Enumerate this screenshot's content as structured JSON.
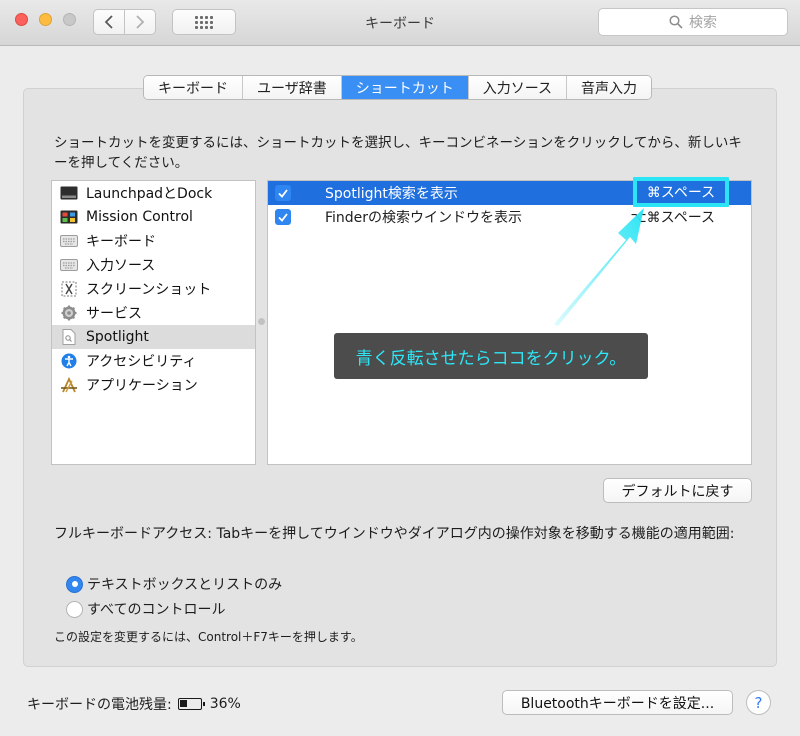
{
  "window": {
    "title": "キーボード"
  },
  "search": {
    "placeholder": "検索"
  },
  "tabs": [
    {
      "label": "キーボード",
      "active": false
    },
    {
      "label": "ユーザ辞書",
      "active": false
    },
    {
      "label": "ショートカット",
      "active": true
    },
    {
      "label": "入力ソース",
      "active": false
    },
    {
      "label": "音声入力",
      "active": false
    }
  ],
  "instructions": "ショートカットを変更するには、ショートカットを選択し、キーコンビネーションをクリックしてから、新しいキーを押してください。",
  "categories": [
    {
      "label": "LaunchpadとDock",
      "icon": "launchpad-icon"
    },
    {
      "label": "Mission Control",
      "icon": "mission-control-icon"
    },
    {
      "label": "キーボード",
      "icon": "keyboard-icon"
    },
    {
      "label": "入力ソース",
      "icon": "keyboard-icon"
    },
    {
      "label": "スクリーンショット",
      "icon": "screenshot-icon"
    },
    {
      "label": "サービス",
      "icon": "gear-icon"
    },
    {
      "label": "Spotlight",
      "icon": "spotlight-icon",
      "selected": true
    },
    {
      "label": "アクセシビリティ",
      "icon": "accessibility-icon"
    },
    {
      "label": "アプリケーション",
      "icon": "app-store-icon"
    }
  ],
  "shortcuts": [
    {
      "label": "Spotlight検索を表示",
      "keys": "⌘スペース",
      "checked": true,
      "selected": true
    },
    {
      "label": "Finderの検索ウインドウを表示",
      "keys": "⌥⌘スペース",
      "checked": true,
      "selected": false
    }
  ],
  "annotation": {
    "highlight_keys": "⌘スペース",
    "callout": "青く反転させたらココをクリック。",
    "color": "#2be4f4"
  },
  "buttons": {
    "restore_defaults": "デフォルトに戻す",
    "bluetooth_setup": "Bluetoothキーボードを設定...",
    "help": "?"
  },
  "full_keyboard_access": {
    "description": "フルキーボードアクセス: Tabキーを押してウインドウやダイアログ内の操作対象を移動する機能の適用範囲:",
    "options": [
      {
        "label": "テキストボックスとリストのみ",
        "selected": true
      },
      {
        "label": "すべてのコントロール",
        "selected": false
      }
    ],
    "note": "この設定を変更するには、Control＋F7キーを押します。"
  },
  "battery": {
    "label": "キーボードの電池残量:",
    "level": "36%"
  },
  "colors": {
    "accent": "#3a8ff4",
    "selection": "#1f6fde"
  }
}
